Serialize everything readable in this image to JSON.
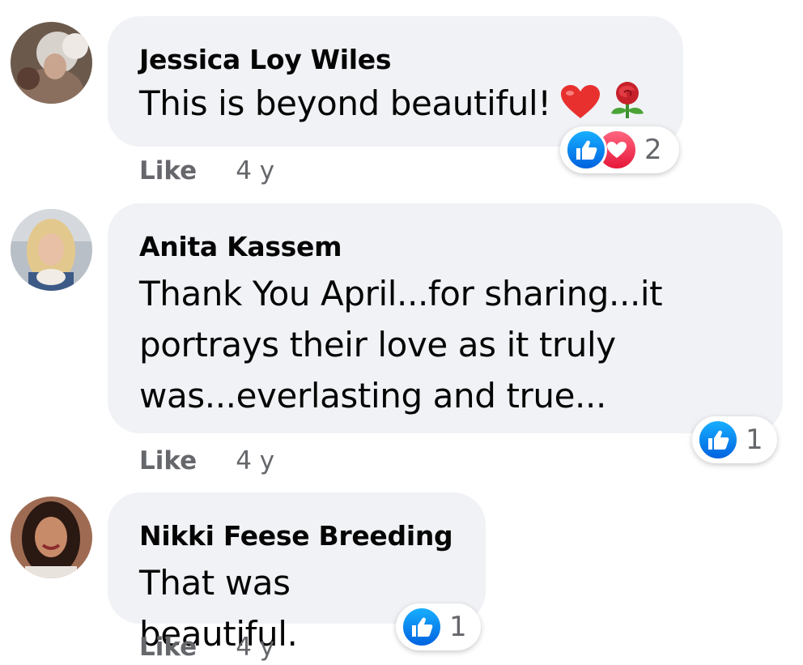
{
  "comments": [
    {
      "author": "Jessica Loy Wiles",
      "text": "This is beyond beautiful!",
      "emojis": [
        "red-heart",
        "rose"
      ],
      "reaction_types": [
        "like",
        "love"
      ],
      "reaction_count": "2",
      "like_label": "Like",
      "timestamp": "4 y"
    },
    {
      "author": "Anita Kassem",
      "text_lines": [
        "Thank You April...for sharing...it",
        "portrays their love as it truly",
        "was...everlasting and true..."
      ],
      "reaction_types": [
        "like"
      ],
      "reaction_count": "1",
      "like_label": "Like",
      "timestamp": "4 y"
    },
    {
      "author": "Nikki Feese Breeding",
      "text": "That was beautiful.",
      "reaction_types": [
        "like"
      ],
      "reaction_count": "1",
      "like_label": "Like",
      "timestamp": "4 y"
    }
  ],
  "colors": {
    "bubble": "#f0f2f5",
    "like_blue": "#1877f2",
    "love_red": "#f33e58",
    "secondary_text": "#65676b"
  }
}
